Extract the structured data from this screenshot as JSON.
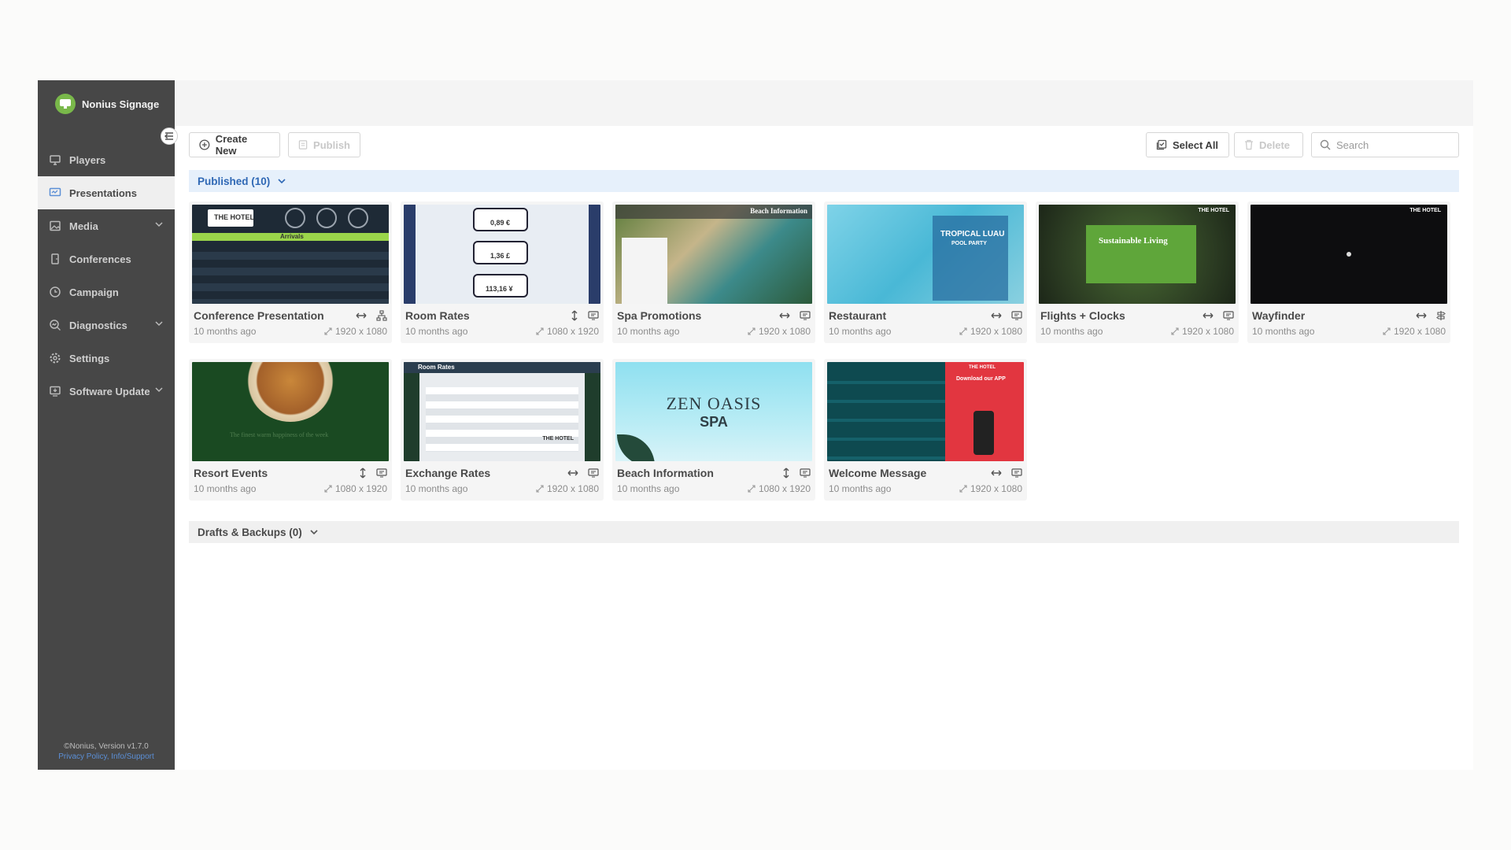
{
  "app": {
    "brand": "Nonius Signage",
    "accent_color": "#79b84a",
    "footer_copyright": "©Nonius, Version v1.7.0",
    "footer_links": "Privacy Policy, Info/Support"
  },
  "sidebar": {
    "items": [
      {
        "label": "Players",
        "icon": "monitor-icon"
      },
      {
        "label": "Presentations",
        "icon": "presentation-icon",
        "active": true
      },
      {
        "label": "Media",
        "icon": "image-icon",
        "expandable": true
      },
      {
        "label": "Conferences",
        "icon": "door-icon"
      },
      {
        "label": "Campaign",
        "icon": "clock-icon"
      },
      {
        "label": "Diagnostics",
        "icon": "magnify-chart-icon",
        "expandable": true
      },
      {
        "label": "Settings",
        "icon": "gear-icon"
      },
      {
        "label": "Software Update",
        "icon": "update-icon",
        "expandable": true
      }
    ]
  },
  "toolbar": {
    "create_new": "Create New",
    "publish": "Publish",
    "select_all": "Select All",
    "delete": "Delete",
    "search_placeholder": "Search"
  },
  "sections": {
    "published": "Published (10)",
    "drafts": "Drafts & Backups (0)"
  },
  "cards": [
    {
      "title": "Conference Presentation",
      "time": "10 months ago",
      "resolution": "1920 x 1080",
      "orientation": "horizontal",
      "target": "network"
    },
    {
      "title": "Room Rates",
      "time": "10 months ago",
      "resolution": "1080 x 1920",
      "orientation": "vertical",
      "target": "screen"
    },
    {
      "title": "Spa Promotions",
      "time": "10 months ago",
      "resolution": "1920 x 1080",
      "orientation": "horizontal",
      "target": "screen"
    },
    {
      "title": "Restaurant",
      "time": "10 months ago",
      "resolution": "1920 x 1080",
      "orientation": "horizontal",
      "target": "screen"
    },
    {
      "title": "Flights + Clocks",
      "time": "10 months ago",
      "resolution": "1920 x 1080",
      "orientation": "horizontal",
      "target": "screen"
    },
    {
      "title": "Wayfinder",
      "time": "10 months ago",
      "resolution": "1920 x 1080",
      "orientation": "horizontal",
      "target": "signpost"
    },
    {
      "title": "Resort Events",
      "time": "10 months ago",
      "resolution": "1080 x 1920",
      "orientation": "vertical",
      "target": "screen"
    },
    {
      "title": "Exchange Rates",
      "time": "10 months ago",
      "resolution": "1920 x 1080",
      "orientation": "horizontal",
      "target": "screen"
    },
    {
      "title": "Beach Information",
      "time": "10 months ago",
      "resolution": "1080 x 1920",
      "orientation": "vertical",
      "target": "screen"
    },
    {
      "title": "Welcome Message",
      "time": "10 months ago",
      "resolution": "1920 x 1080",
      "orientation": "horizontal",
      "target": "screen"
    }
  ],
  "thumbs": {
    "conference": {
      "logo": "THE HOTEL",
      "banner": "Arrivals"
    },
    "room_rates": {
      "rate1": "0,89 €",
      "rate2": "1,36 £",
      "rate3": "113,16 ¥"
    },
    "spa": {
      "title": "Beach Information"
    },
    "restaurant": {
      "title": "TROPICAL LUAU",
      "subtitle": "POOL PARTY"
    },
    "flights": {
      "title": "Sustainable Living",
      "logo": "THE HOTEL"
    },
    "wayfinder": {
      "logo": "THE HOTEL"
    },
    "resort": {
      "caption": "The finest warm happiness of the week"
    },
    "exchange": {
      "title": "Room Rates",
      "logo": "THE HOTEL"
    },
    "zen": {
      "line1": "ZEN OASIS",
      "line2": "SPA"
    },
    "welcome": {
      "logo": "THE HOTEL",
      "promo": "Download our APP"
    }
  }
}
